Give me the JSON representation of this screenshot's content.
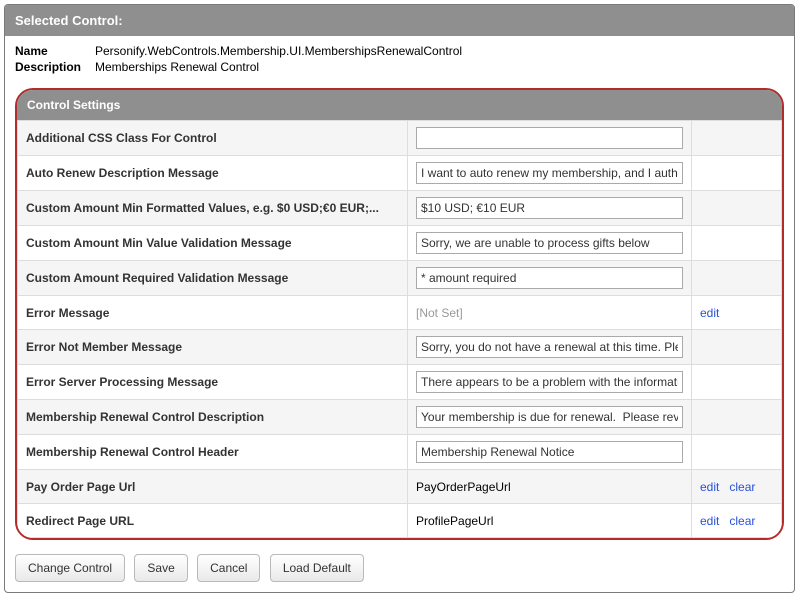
{
  "selected": {
    "header": "Selected Control:",
    "nameLabel": "Name",
    "nameValue": "Personify.WebControls.Membership.UI.MembershipsRenewalControl",
    "descLabel": "Description",
    "descValue": "Memberships Renewal Control"
  },
  "settings": {
    "header": "Control Settings",
    "notSet": "[Not Set]",
    "rows": [
      {
        "label": "Additional CSS Class For Control",
        "type": "input",
        "value": ""
      },
      {
        "label": "Auto Renew Description Message",
        "type": "input",
        "value": "I want to auto renew my membership, and I authorize"
      },
      {
        "label": "Custom Amount Min Formatted Values, e.g. $0 USD;€0 EUR;...",
        "type": "input",
        "value": "$10 USD; €10 EUR"
      },
      {
        "label": "Custom Amount Min Value Validation Message",
        "type": "input",
        "value": "Sorry, we are unable to process gifts below"
      },
      {
        "label": "Custom Amount Required Validation Message",
        "type": "input",
        "value": "* amount required"
      },
      {
        "label": "Error Message",
        "type": "notset",
        "value": "[Not Set]",
        "edit": true
      },
      {
        "label": "Error Not Member Message",
        "type": "input",
        "value": "Sorry, you do not have a renewal at this time. Please"
      },
      {
        "label": "Error Server Processing Message",
        "type": "input",
        "value": "There appears to be a problem with the information p"
      },
      {
        "label": "Membership Renewal Control Description",
        "type": "input",
        "value": "Your membership is due for renewal.  Please review"
      },
      {
        "label": "Membership Renewal Control Header",
        "type": "input",
        "value": "Membership Renewal Notice"
      },
      {
        "label": "Pay Order Page Url",
        "type": "text",
        "value": "PayOrderPageUrl",
        "edit": true,
        "clear": true
      },
      {
        "label": "Redirect Page URL",
        "type": "text",
        "value": "ProfilePageUrl",
        "edit": true,
        "clear": true
      }
    ]
  },
  "actions": {
    "edit": "edit",
    "clear": "clear"
  },
  "buttons": {
    "change": "Change Control",
    "save": "Save",
    "cancel": "Cancel",
    "loadDefault": "Load Default"
  }
}
